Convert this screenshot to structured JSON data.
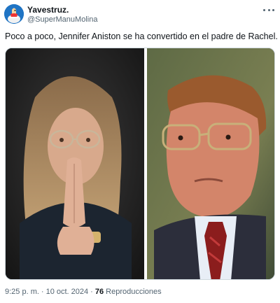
{
  "author": {
    "display_name": "Yavestruz.",
    "handle": "@SuperManuMolina",
    "avatar_icon": "ostrich-avatar-icon"
  },
  "tweet": {
    "text": "Poco a poco, Jennifer Aniston se ha convertido en el padre de Rachel.",
    "media_description_left": "woman with glasses and pressed hands",
    "media_description_right": "older man with glasses, suit and red tie"
  },
  "meta": {
    "time": "9:25 p. m.",
    "separator": "·",
    "date": "10 oct. 2024",
    "views_count": "76",
    "views_label": "Reproducciones"
  },
  "colors": {
    "text_primary": "#0f1419",
    "text_secondary": "#536471",
    "border": "#cfd9de"
  }
}
